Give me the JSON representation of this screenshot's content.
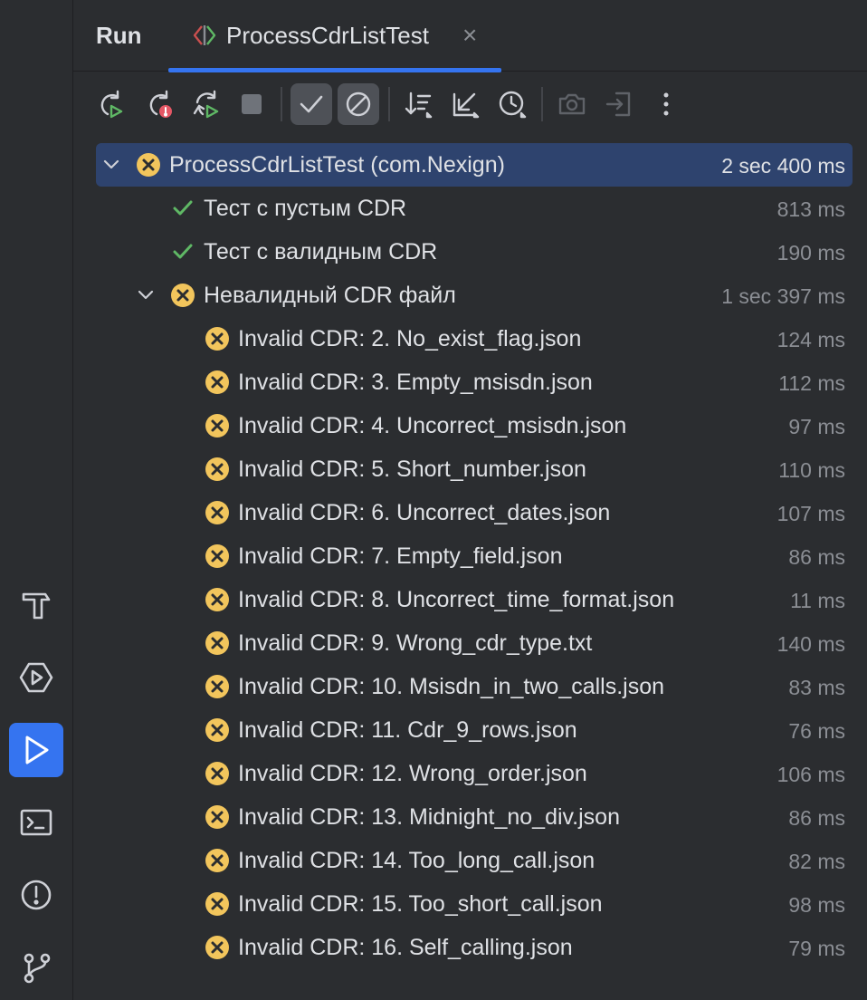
{
  "tabbar": {
    "run_label": "Run",
    "tab_title": "ProcessCdrListTest",
    "close_glyph": "×"
  },
  "toolbar": {
    "buttons": [
      {
        "icon": "rerun-icon"
      },
      {
        "icon": "rerun-failed-icon"
      },
      {
        "icon": "toggle-auto-rerun-icon"
      },
      {
        "icon": "stop-icon"
      },
      {
        "icon": "show-passed-icon",
        "toggled": true
      },
      {
        "icon": "show-ignored-icon",
        "toggled": true
      },
      {
        "icon": "sort-icon"
      },
      {
        "icon": "collapse-all-icon"
      },
      {
        "icon": "history-icon"
      },
      {
        "icon": "screenshot-icon"
      },
      {
        "icon": "export-icon"
      },
      {
        "icon": "more-icon"
      }
    ]
  },
  "colors": {
    "accent": "#3574f0",
    "fail": "#f2c55c",
    "pass": "#5fb865",
    "selected": "#2e436e"
  },
  "tree": {
    "root": {
      "name": "ProcessCdrListTest (com.Nexign)",
      "duration": "2 sec 400 ms",
      "status": "failed"
    },
    "tests": [
      {
        "name": "Тест с пустым CDR",
        "duration": "813 ms",
        "status": "passed"
      },
      {
        "name": "Тест с валидным CDR",
        "duration": "190 ms",
        "status": "passed"
      }
    ],
    "group": {
      "name": "Невалидный CDR файл",
      "duration": "1 sec 397 ms",
      "status": "failed"
    },
    "cases": [
      {
        "name": "Invalid CDR: 2. No_exist_flag.json",
        "duration": "124 ms"
      },
      {
        "name": "Invalid CDR: 3. Empty_msisdn.json",
        "duration": "112 ms"
      },
      {
        "name": "Invalid CDR: 4. Uncorrect_msisdn.json",
        "duration": "97 ms"
      },
      {
        "name": "Invalid CDR: 5. Short_number.json",
        "duration": "110 ms"
      },
      {
        "name": "Invalid CDR: 6. Uncorrect_dates.json",
        "duration": "107 ms"
      },
      {
        "name": "Invalid CDR: 7. Empty_field.json",
        "duration": "86 ms"
      },
      {
        "name": "Invalid CDR: 8. Uncorrect_time_format.json",
        "duration": "11 ms"
      },
      {
        "name": "Invalid CDR: 9. Wrong_cdr_type.txt",
        "duration": "140 ms"
      },
      {
        "name": "Invalid CDR: 10. Msisdn_in_two_calls.json",
        "duration": "83 ms"
      },
      {
        "name": "Invalid CDR: 11. Cdr_9_rows.json",
        "duration": "76 ms"
      },
      {
        "name": "Invalid CDR: 12. Wrong_order.json",
        "duration": "106 ms"
      },
      {
        "name": "Invalid CDR: 13. Midnight_no_div.json",
        "duration": "86 ms"
      },
      {
        "name": "Invalid CDR: 14. Too_long_call.json",
        "duration": "82 ms"
      },
      {
        "name": "Invalid CDR: 15. Too_short_call.json",
        "duration": "98 ms"
      },
      {
        "name": "Invalid CDR: 16. Self_calling.json",
        "duration": "79 ms"
      }
    ]
  },
  "rail": {
    "items": [
      "build-icon",
      "services-icon",
      "run-icon",
      "terminal-icon",
      "problems-icon",
      "git-icon"
    ],
    "active": "run-icon"
  }
}
